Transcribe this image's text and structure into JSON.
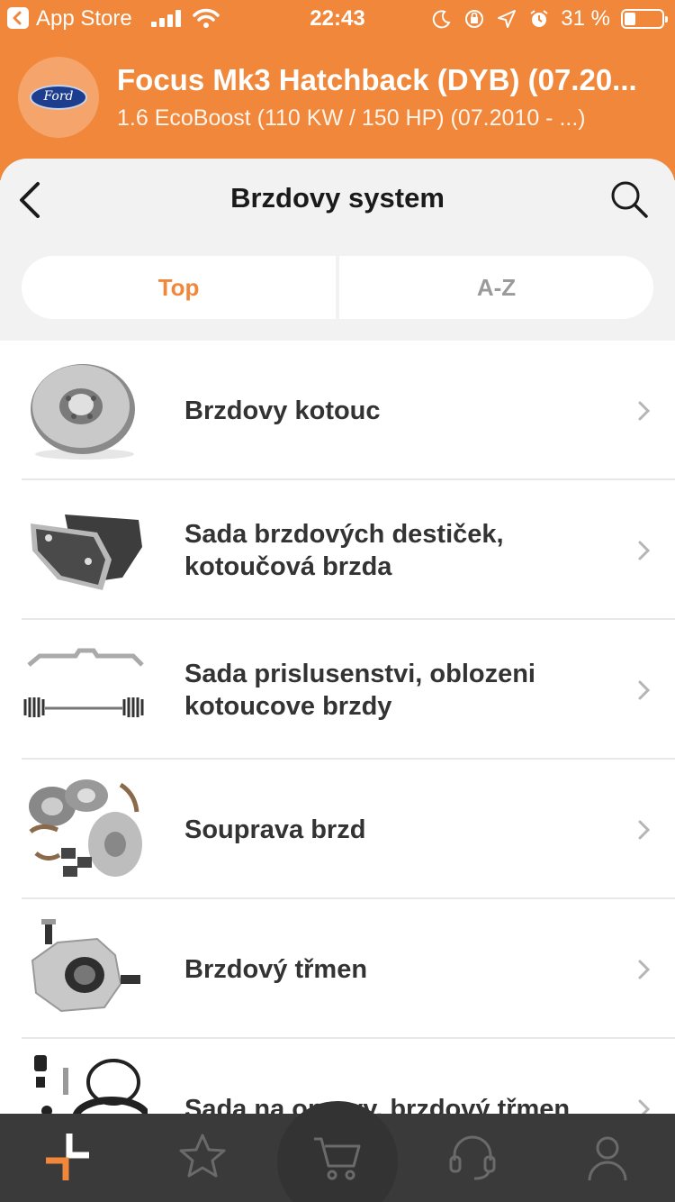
{
  "status_bar": {
    "back_app": "App Store",
    "time": "22:43",
    "battery": "31 %"
  },
  "vehicle": {
    "brand": "Ford",
    "title": "Focus Mk3 Hatchback (DYB) (07.20...",
    "subtitle": "1.6 EcoBoost (110 KW / 150 HP) (07.2010 - ...)"
  },
  "nav": {
    "title": "Brzdovy system",
    "back_icon": "chevron-left-icon",
    "search_icon": "search-icon"
  },
  "segments": {
    "top_label": "Top",
    "az_label": "A-Z",
    "active": "Top"
  },
  "categories": [
    {
      "label": "Brzdovy kotouc",
      "icon": "brake-disc-image"
    },
    {
      "label": "Sada brzdových destiček, kotoučová brzda",
      "icon": "brake-pads-image"
    },
    {
      "label": "Sada prislusenstvi, oblozeni kotoucove brzdy",
      "icon": "accessory-kit-image"
    },
    {
      "label": "Souprava brzd",
      "icon": "brake-set-image"
    },
    {
      "label": "Brzdový třmen",
      "icon": "brake-caliper-image"
    },
    {
      "label": "Sada na opravy, brzdový třmen",
      "icon": "repair-kit-image"
    }
  ],
  "tabbar": {
    "items": [
      "home-icon",
      "star-icon",
      "cart-icon",
      "support-icon",
      "profile-icon"
    ],
    "active": "home-icon"
  },
  "colors": {
    "accent": "#f0873a",
    "tabbar": "#3a3a3a",
    "text": "#333333"
  }
}
